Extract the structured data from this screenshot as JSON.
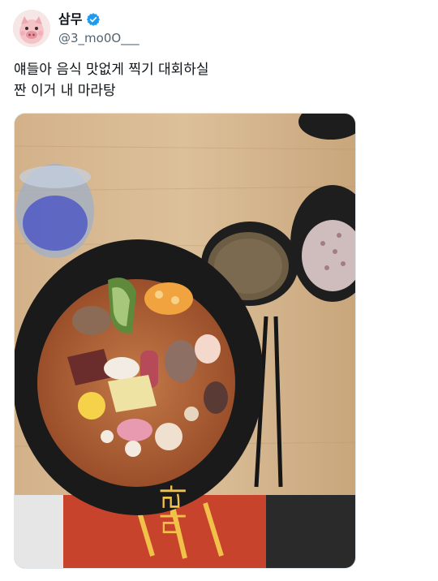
{
  "tweet": {
    "display_name": "삼무",
    "handle": "@3_mo0O___",
    "text_line1": "얘들아 음식 맛없게 찍기 대회하실",
    "text_line2": "짠 이거 내 마라탕",
    "media_text": "마라"
  },
  "icons": {
    "verified": "verified-badge-icon",
    "avatar": "pig-avatar"
  },
  "colors": {
    "verified_blue": "#1d9bf0",
    "handle_gray": "#536471"
  }
}
